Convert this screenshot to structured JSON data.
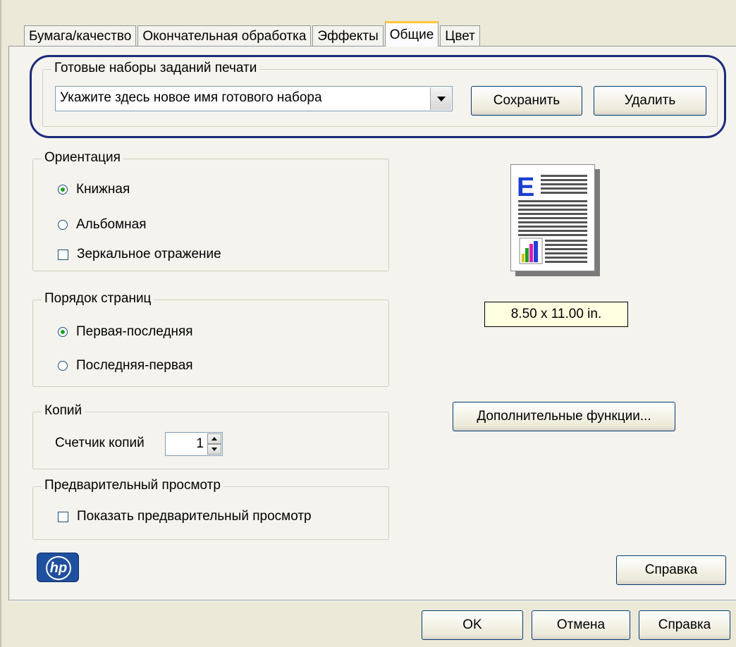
{
  "tabs": [
    {
      "label": "Бумага/качество",
      "active": false
    },
    {
      "label": "Окончательная обработка",
      "active": false
    },
    {
      "label": "Эффекты",
      "active": false
    },
    {
      "label": "Общие",
      "active": true
    },
    {
      "label": "Цвет",
      "active": false
    }
  ],
  "presets": {
    "group_title": "Готовые наборы заданий печати",
    "combo_value": "Укажите здесь новое имя готового набора",
    "save_label": "Сохранить",
    "delete_label": "Удалить"
  },
  "orientation": {
    "group_title": "Ориентация",
    "portrait": "Книжная",
    "landscape": "Альбомная",
    "mirror": "Зеркальное отражение",
    "selected": "portrait"
  },
  "page_order": {
    "group_title": "Порядок страниц",
    "first_last": "Первая-последняя",
    "last_first": "Последняя-первая",
    "selected": "first_last"
  },
  "copies": {
    "group_title": "Копий",
    "counter_label": "Счетчик копий",
    "value": "1"
  },
  "preview": {
    "group_title": "Предварительный просмотр",
    "show_label": "Показать предварительный просмотр",
    "page_size": "8.50 x 11.00 in."
  },
  "advanced_label": "Дополнительные функции...",
  "help_label": "Справка",
  "footer": {
    "ok_label": "OK",
    "cancel_label": "Отмена",
    "help_label": "Справка"
  },
  "colors": {
    "accent_tab": "#ffc83c",
    "highlight_ring": "#1c2a7a",
    "hp_blue": "#1f4f9f"
  }
}
